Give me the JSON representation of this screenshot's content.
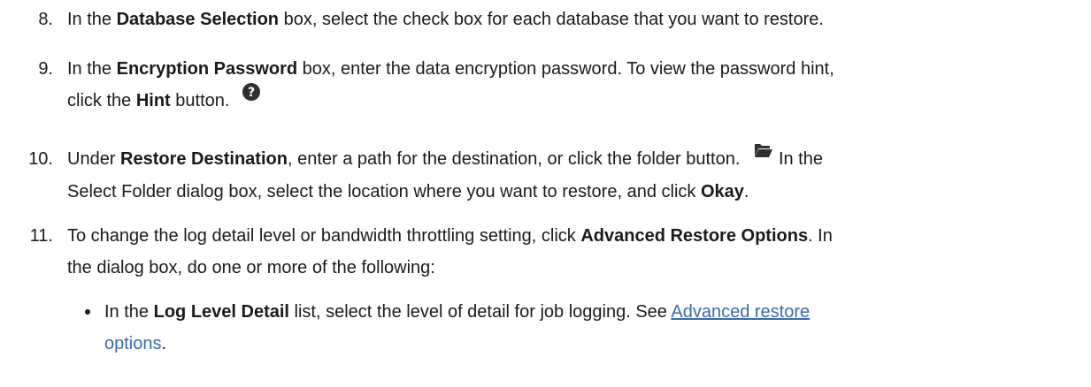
{
  "steps": [
    {
      "number": "8.",
      "lines": [
        {
          "pre": "In the ",
          "bold": "Database Selection",
          "post": " box, select the check box for each database that you want to restore."
        }
      ]
    },
    {
      "number": "9.",
      "line1": {
        "pre": "In the ",
        "bold": "Encryption Password",
        "post": " box, enter the data encryption password. To view the password hint,"
      },
      "line2": {
        "pre": "click the ",
        "bold": "Hint",
        "post": " button."
      },
      "icon": "help-circle-icon"
    },
    {
      "number": "10.",
      "line1": {
        "pre": "Under ",
        "bold": "Restore Destination",
        "post": ", enter a path for the destination, or click the folder button.",
        "after_icon": " In the"
      },
      "icon": "folder-open-icon",
      "line2": {
        "pre": "Select Folder dialog box, select the location where you want to restore, and click ",
        "bold": "Okay",
        "post": "."
      }
    },
    {
      "number": "11.",
      "line1": {
        "pre": "To change the log detail level or bandwidth throttling setting, click ",
        "bold": "Advanced Restore Options",
        "post": ". In"
      },
      "line2": {
        "text": "the dialog box, do one or more of the following:"
      }
    }
  ],
  "bullet": {
    "pre": "In the ",
    "bold": "Log Level Detail",
    "post": " list, select the level of detail for job logging. See ",
    "link_line1": "Advanced restore ",
    "link_line2": "options",
    "after_link": "."
  },
  "colors": {
    "text": "#1a1a1a",
    "link": "#3a6bb0",
    "icon": "#2f2f2f"
  }
}
